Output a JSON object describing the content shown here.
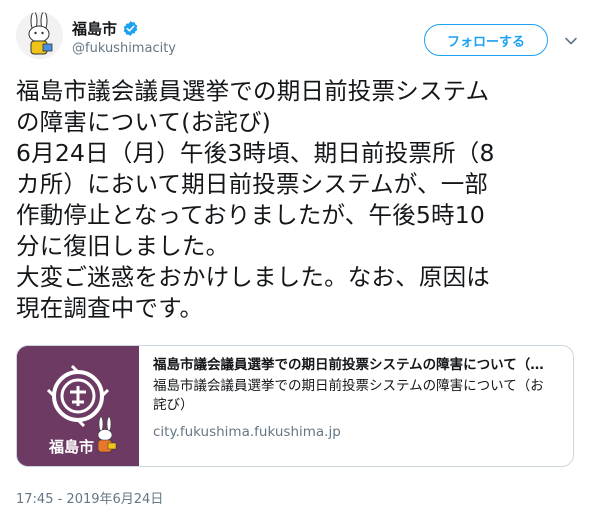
{
  "user": {
    "display_name": "福島市",
    "handle": "@fukushimacity"
  },
  "actions": {
    "follow_label": "フォローする"
  },
  "tweet": {
    "lines": [
      "福島市議会議員選挙での期日前投票システム",
      "の障害について(お詫び)",
      "6月24日（月）午後3時頃、期日前投票所（8",
      "カ所）において期日前投票システムが、一部",
      "作動停止となっておりましたが、午後5時10",
      "分に復旧しました。",
      "大変ご迷惑をおかけしました。なお、原因は",
      "現在調査中です。"
    ],
    "timestamp": "17:45 - 2019年6月24日"
  },
  "card": {
    "thumb_label": "福島市",
    "title": "福島市議会議員選挙での期日前投票システムの障害について（…",
    "description_lines": [
      "福島市議会議員選挙での期日前投票システムの障害について（お",
      "詫び）"
    ],
    "domain": "city.fukushima.fukushima.jp"
  },
  "colors": {
    "accent": "#1da1f2",
    "card_thumb_bg": "#6d3a63"
  }
}
